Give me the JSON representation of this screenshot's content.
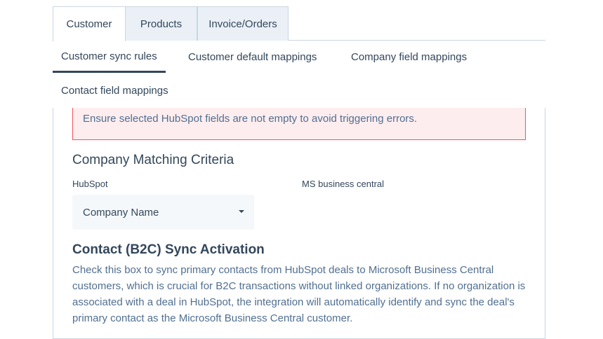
{
  "top_tabs": [
    {
      "label": "Customer",
      "active": true
    },
    {
      "label": "Products",
      "active": false
    },
    {
      "label": "Invoice/Orders",
      "active": false
    }
  ],
  "sub_tabs": [
    {
      "label": "Customer sync rules",
      "active": true
    },
    {
      "label": "Customer default mappings",
      "active": false
    },
    {
      "label": "Company field mappings",
      "active": false
    },
    {
      "label": "Contact field mappings",
      "active": false
    }
  ],
  "alert": {
    "text": "Ensure selected HubSpot fields are not empty to avoid triggering errors."
  },
  "company_matching": {
    "title": "Company Matching Criteria",
    "hubspot_label": "HubSpot",
    "ms_label": "MS business central",
    "hubspot_select_value": "Company Name"
  },
  "b2c": {
    "title": "Contact (B2C) Sync Activation",
    "description": "Check this box to sync primary contacts from HubSpot deals to Microsoft Business Central customers, which is crucial for B2C transactions without linked organizations. If no organization is associated with a deal in HubSpot, the integration will automatically identify and sync the deal's primary contact as the Microsoft Business Central customer."
  },
  "colors": {
    "text": "#33475b",
    "muted_text": "#516f90",
    "border": "#cbd6e2",
    "tab_inactive_bg": "#eaf0f6",
    "alert_bg": "#fdedee",
    "alert_border": "#f2545b",
    "select_bg": "#f5f8fa"
  }
}
